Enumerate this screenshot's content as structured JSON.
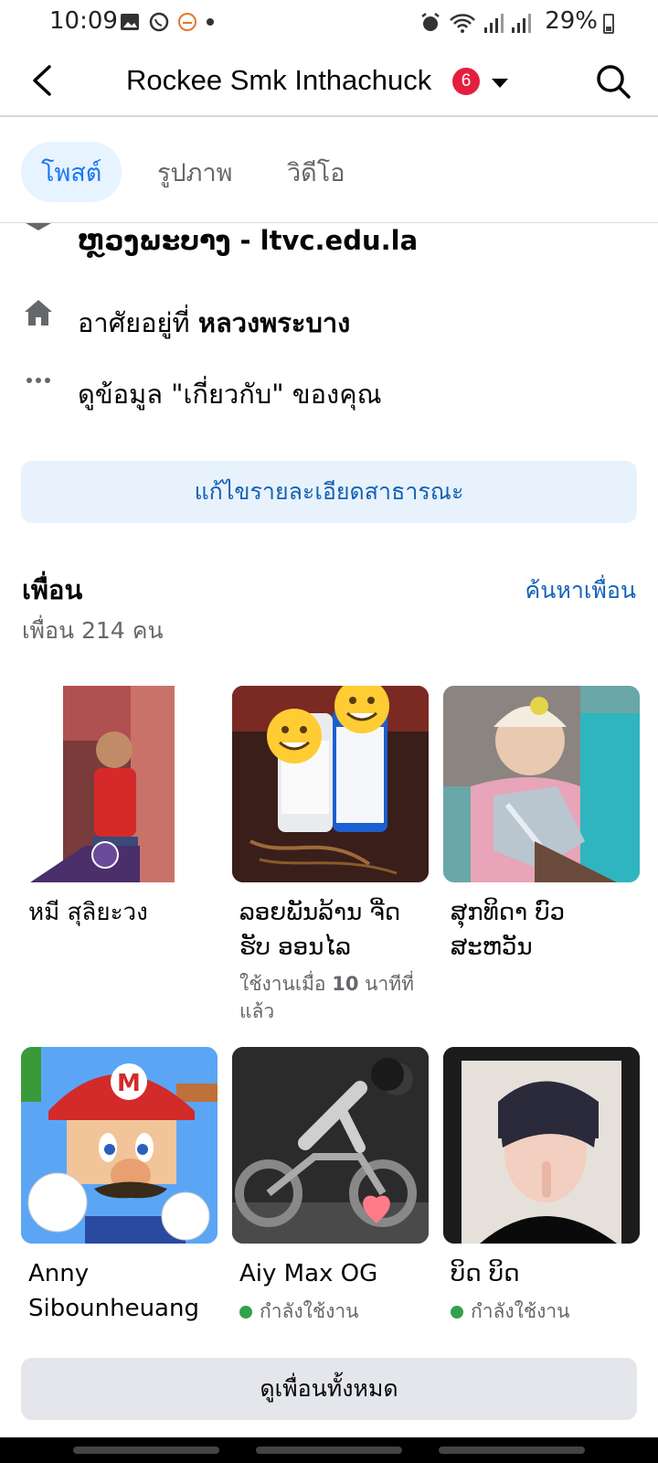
{
  "status": {
    "time": "10:09",
    "battery": "29%"
  },
  "header": {
    "title": "Rockee Smk Inthachuck",
    "badge": "6"
  },
  "tabs": [
    {
      "label": "โพสต์",
      "active": true
    },
    {
      "label": "รูปภาพ",
      "active": false
    },
    {
      "label": "วิดีโอ",
      "active": false
    }
  ],
  "about": {
    "education_text": "ຫຼວງພະບາງ - ltvc.edu.la",
    "lives_prefix": "อาศัยอยู่ที่ ",
    "lives_place": "หลวงพระบาง",
    "see_about": "ดูข้อมูล \"เกี่ยวกับ\" ของคุณ"
  },
  "edit_button": "แก้ไขรายละเอียดสาธารณะ",
  "friends": {
    "title": "เพื่อน",
    "find_link": "ค้นหาเพื่อน",
    "count_text": "เพื่อน 214 คน",
    "items": [
      {
        "name": "หมี สุลิยะวง"
      },
      {
        "name": "ລອຍພັນລ້ານ ຈີ່ດ ຮັບ ອອນໄລ",
        "sub_prefix": "ใช้งานเมื่อ ",
        "sub_bold": "10",
        "sub_suffix": " นาทีที่แล้ว"
      },
      {
        "name": "ສຸກທິດາ ບົວສະຫວັນ"
      },
      {
        "name": "Anny Sibounheuang"
      },
      {
        "name": "Aiy Max OG",
        "status": "กำลังใช้งาน"
      },
      {
        "name": "ບິດ ບິດ",
        "status": "กำลังใช้งาน"
      }
    ],
    "see_all": "ดูเพื่อนทั้งหมด"
  },
  "colors": {
    "accent": "#1877f2",
    "link": "#1462b5",
    "badge": "#e41e3f",
    "online": "#31a24c"
  }
}
